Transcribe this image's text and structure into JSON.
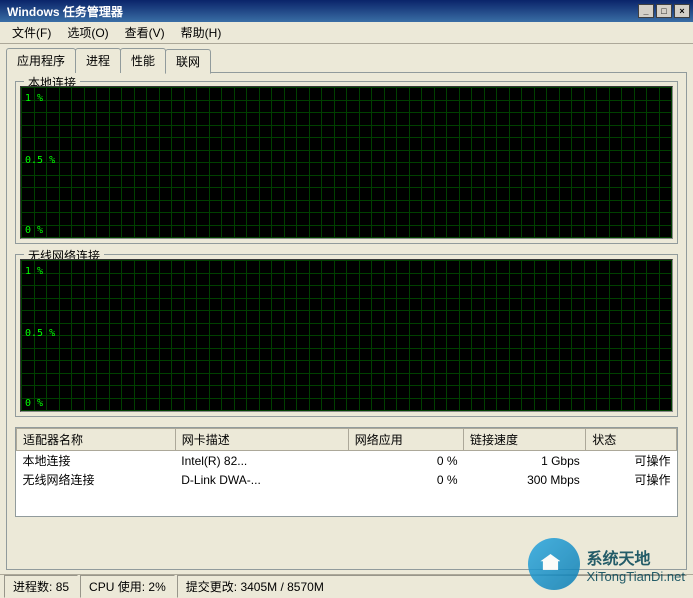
{
  "title": "Windows 任务管理器",
  "menus": [
    "文件(F)",
    "选项(O)",
    "查看(V)",
    "帮助(H)"
  ],
  "tabs": [
    "应用程序",
    "进程",
    "性能",
    "联网"
  ],
  "active_tab": 3,
  "graphs": [
    {
      "label": "本地连接",
      "yticks": [
        "1 %",
        "0.5 %",
        "0 %"
      ]
    },
    {
      "label": "无线网络连接",
      "yticks": [
        "1 %",
        "0.5 %",
        "0 %"
      ]
    }
  ],
  "table": {
    "headers": [
      "适配器名称",
      "网卡描述",
      "网络应用",
      "链接速度",
      "状态"
    ],
    "rows": [
      [
        "本地连接",
        "Intel(R) 82...",
        "0 %",
        "1 Gbps",
        "可操作"
      ],
      [
        "无线网络连接",
        "D-Link DWA-...",
        "0 %",
        "300 Mbps",
        "可操作"
      ]
    ]
  },
  "status": {
    "processes_label": "进程数:",
    "processes": "85",
    "cpu_label": "CPU 使用:",
    "cpu": "2%",
    "commit_label": "提交更改:",
    "commit": "3405M / 8570M"
  },
  "watermark": {
    "cn": "系统天地",
    "en": "XiTongTianDi.net"
  },
  "chart_data": [
    {
      "type": "line",
      "title": "本地连接",
      "ylabel": "%",
      "ylim": [
        0,
        1
      ],
      "x": null,
      "values": "flat ~0"
    },
    {
      "type": "line",
      "title": "无线网络连接",
      "ylabel": "%",
      "ylim": [
        0,
        1
      ],
      "x": null,
      "values": "flat ~0"
    }
  ]
}
